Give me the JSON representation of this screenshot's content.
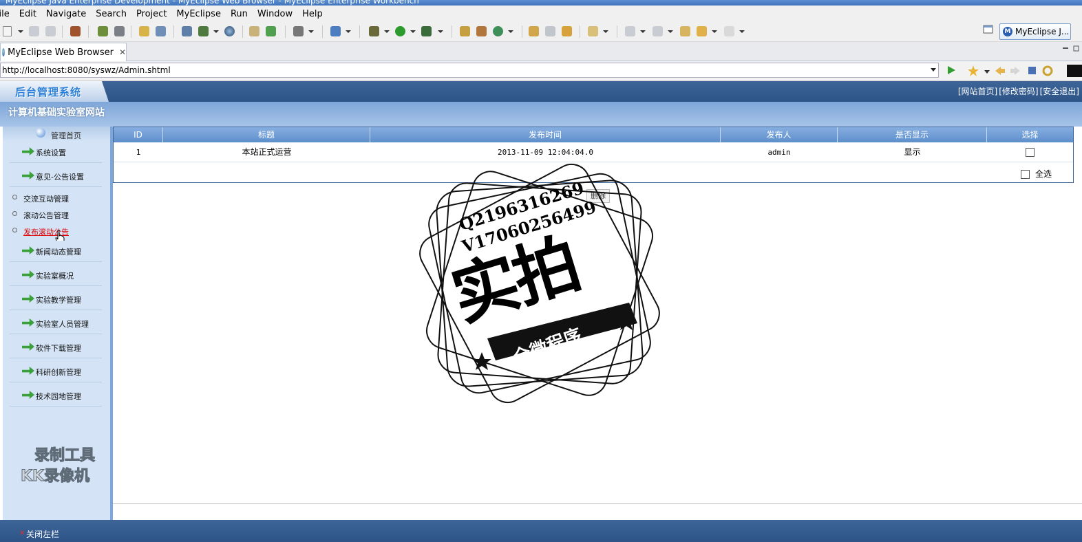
{
  "window": {
    "title": "MyEclipse Java Enterprise Development - MyEclipse Web Browser - MyEclipse Enterprise Workbench"
  },
  "menu": [
    "File",
    "Edit",
    "Navigate",
    "Search",
    "Project",
    "MyEclipse",
    "Run",
    "Window",
    "Help"
  ],
  "perspective": {
    "label": "MyEclipse J..."
  },
  "editor_tab": {
    "label": "MyEclipse Web Browser",
    "close": "✕"
  },
  "browser": {
    "url": "http://localhost:8080/syswz/Admin.shtml"
  },
  "site": {
    "logo": "后台管理系统",
    "subtitle": "计算机基础实验室网站",
    "top_links": [
      "[网站首页]",
      "[修改密码]",
      "[安全退出]"
    ]
  },
  "sidebar": {
    "home": "管理首页",
    "items": [
      {
        "label": "系统设置"
      },
      {
        "label": "意见-公告设置"
      },
      {
        "label": "新闻动态管理"
      },
      {
        "label": "实验室概况"
      },
      {
        "label": "实验教学管理"
      },
      {
        "label": "实验室人员管理"
      },
      {
        "label": "软件下载管理"
      },
      {
        "label": "科研创新管理"
      },
      {
        "label": "技术园地管理"
      }
    ],
    "subitems": [
      {
        "label": "交流互动管理"
      },
      {
        "label": "滚动公告管理"
      },
      {
        "label": "发布滚动公告"
      }
    ],
    "close_left": "关闭左栏"
  },
  "table": {
    "headers": [
      "ID",
      "标题",
      "发布时间",
      "发布人",
      "是否显示",
      "选择"
    ],
    "rows": [
      {
        "id": "1",
        "title": "本站正式运营",
        "time": "2013-11-09 12:04:04.0",
        "author": "admin",
        "show": "显示"
      }
    ],
    "select_all": "全选",
    "delete": "删除"
  },
  "watermarks": {
    "recorder_line1": "录制工具",
    "recorder_line2": "KK录像机",
    "stamp_phone1": "Q2196316269",
    "stamp_phone2": "V17060256499",
    "stamp_big": "实拍",
    "stamp_banner": "全微程序"
  }
}
